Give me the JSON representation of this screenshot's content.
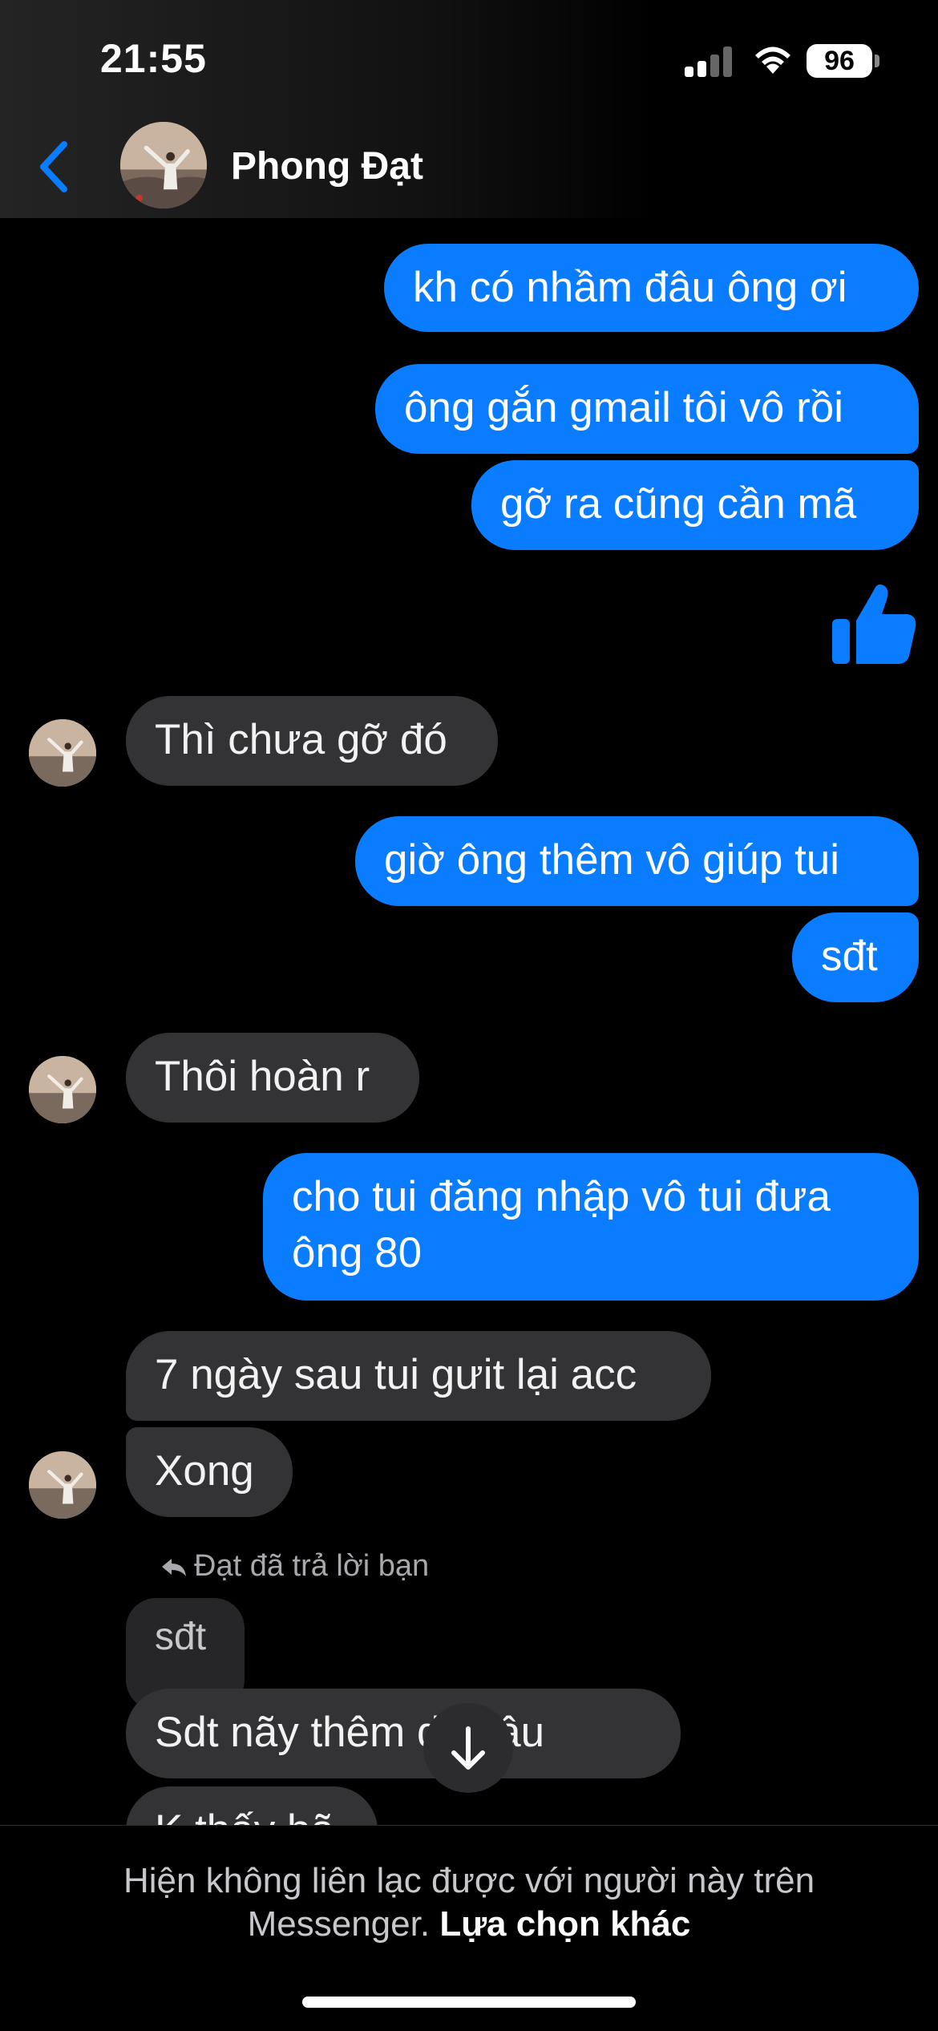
{
  "status_bar": {
    "time": "21:55",
    "battery": "96"
  },
  "header": {
    "contact_name": "Phong Đạt"
  },
  "messages": {
    "m1": "kh có nhầm đâu ông ơi",
    "m2": "ông gắn gmail tôi vô rồi",
    "m3": "gỡ ra cũng cần mã",
    "m4": "Thì chưa gỡ đó",
    "m5": "giờ ông thêm vô giúp tui",
    "m6": "sđt",
    "m7": "Thôi hoàn r",
    "m8_line1": "cho tui đăng nhập vô tui đưa",
    "m8_line2": "ông 80",
    "m9": "7 ngày sau tui gưit lại acc",
    "m10": "Xong",
    "reply_note": "Đạt đã trả lời bạn",
    "m11_quoted": "sđt",
    "m12": "Sdt nãy thêm dc đâu",
    "m13_partial": "K thấy bã"
  },
  "footer": {
    "notice": "Hiện không liên lạc được với người này trên Messenger.",
    "link": "Lựa chọn khác"
  },
  "colors": {
    "my_bubble": "#0a7cff",
    "their_bubble": "#333335",
    "accent": "#0a7cff"
  }
}
